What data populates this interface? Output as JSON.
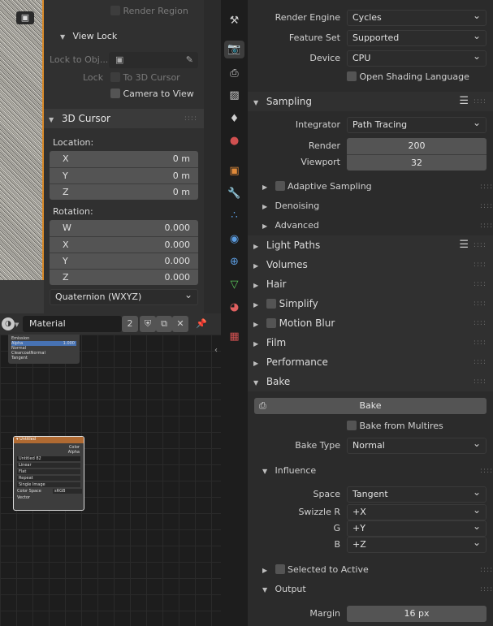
{
  "viewport": {
    "render_region_label": "Render Region",
    "view_lock_label": "View Lock",
    "lock_to_object_label": "Lock to Obj...",
    "lock_label": "Lock",
    "to_3d_cursor_label": "To 3D Cursor",
    "camera_to_view_label": "Camera to View",
    "cursor_section_label": "3D Cursor",
    "location_label": "Location:",
    "location": [
      {
        "axis": "X",
        "value": "0 m"
      },
      {
        "axis": "Y",
        "value": "0 m"
      },
      {
        "axis": "Z",
        "value": "0 m"
      }
    ],
    "rotation_label": "Rotation:",
    "rotation": [
      {
        "axis": "W",
        "value": "0.000"
      },
      {
        "axis": "X",
        "value": "0.000"
      },
      {
        "axis": "Y",
        "value": "0.000"
      },
      {
        "axis": "Z",
        "value": "0.000"
      }
    ],
    "rotation_mode": "Quaternion (WXYZ)"
  },
  "node_editor": {
    "material_name": "Material",
    "user_count": "2",
    "node_socket_list": [
      "Emission",
      "Alpha",
      "Normal",
      "ClearcoatNormal",
      "Tangent"
    ],
    "alpha_value": "1.000",
    "image_node": {
      "title": "Untitled",
      "outputs": [
        "Color",
        "Alpha"
      ],
      "image_name": "Untitled",
      "image_users": "82",
      "options": [
        "Linear",
        "Flat",
        "Repeat",
        "Single Image"
      ],
      "color_space_label": "Color Space",
      "color_space": "sRGB",
      "vector_label": "Vector"
    }
  },
  "properties": {
    "render_engine_label": "Render Engine",
    "render_engine": "Cycles",
    "feature_set_label": "Feature Set",
    "feature_set": "Supported",
    "device_label": "Device",
    "device": "CPU",
    "open_shading_language": "Open Shading Language",
    "sampling": {
      "label": "Sampling",
      "integrator_label": "Integrator",
      "integrator": "Path Tracing",
      "render_label": "Render",
      "render": "200",
      "viewport_label": "Viewport",
      "viewport": "32",
      "adaptive": "Adaptive Sampling",
      "denoising": "Denoising",
      "advanced": "Advanced"
    },
    "sections": [
      "Light Paths",
      "Volumes",
      "Hair",
      "Simplify",
      "Motion Blur",
      "Film",
      "Performance"
    ],
    "bake": {
      "label": "Bake",
      "button": "Bake",
      "from_multires": "Bake from Multires",
      "type_label": "Bake Type",
      "type": "Normal",
      "influence": "Influence",
      "space_label": "Space",
      "space": "Tangent",
      "swizzle_r_label": "Swizzle R",
      "swizzle_r": "+X",
      "g_label": "G",
      "g": "+Y",
      "b_label": "B",
      "b": "+Z",
      "selected_to_active": "Selected to Active",
      "output": "Output",
      "margin_label": "Margin",
      "margin": "16 px"
    }
  },
  "colors": {
    "accent": "#4772b3",
    "orange": "#d98a2a"
  }
}
